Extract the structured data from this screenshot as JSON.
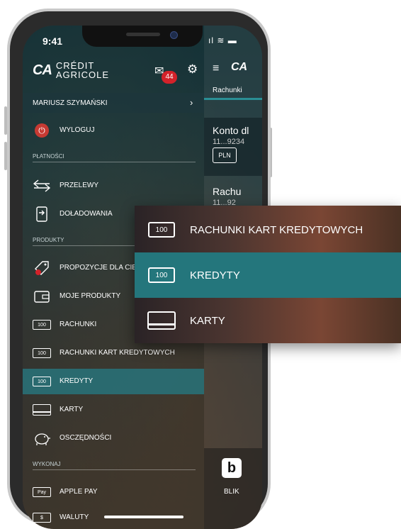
{
  "status": {
    "time": "9:41",
    "icons": "ıl ≋ ▬"
  },
  "brand": {
    "mark": "CA",
    "name_line1": "CRÉDIT",
    "name_line2": "AGRICOLE"
  },
  "header": {
    "mail_badge": "44",
    "mail_icon": "✉",
    "settings_icon": "⚙"
  },
  "user": {
    "name": "MARIUSZ SZYMAŃSKI",
    "chevron": "›"
  },
  "menu": {
    "logout": "WYLOGUJ",
    "section_payments": "PŁATNOŚCI",
    "transfers": "PRZELEWY",
    "topups": "DOŁADOWANIA",
    "section_products": "PRODUKTY",
    "offers": "PROPOZYCJE DLA CIE",
    "my_products": "MOJE PRODUKTY",
    "accounts": "RACHUNKI",
    "credit_card_accounts": "RACHUNKI KART KREDYTOWYCH",
    "loans": "KREDYTY",
    "cards": "KARTY",
    "savings": "OSCZĘDNOŚCI",
    "section_execute": "WYKONAJ",
    "apple_pay": "APPLE PAY",
    "currencies": "WALUTY",
    "note_label": "100",
    "applepay_label": "Pay",
    "currency_label": "$"
  },
  "right_pane": {
    "menu_icon": "≡",
    "logo_mark": "CA",
    "tab": "Rachunki",
    "account1_name": "Konto dl",
    "account1_number": "11...9234",
    "currency_tag": "PLN",
    "account2_name": "Rachu",
    "account2_number": "11...92",
    "blik_icon": "b",
    "blik_label": "BLIK"
  },
  "popup": {
    "row1": "RACHUNKI KART KREDYTOWYCH",
    "row2": "KREDYTY",
    "row3": "KARTY",
    "note_label": "100"
  }
}
